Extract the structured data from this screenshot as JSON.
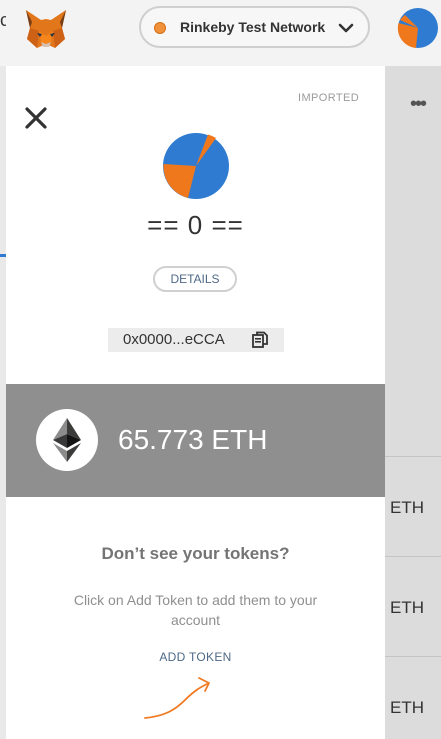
{
  "header": {
    "network_label": "Rinkeby Test Network",
    "left_cut_text": "c",
    "icons": {
      "logo": "metamask-fox-icon",
      "chevron": "chevron-down-icon",
      "avatar": "account-avatar-icon"
    },
    "colors": {
      "network_dot": "#f0913c"
    }
  },
  "background_page": {
    "menu_label": "•••",
    "eth_labels": [
      "ETH",
      "ETH",
      "ETH"
    ]
  },
  "modal": {
    "imported_label": "IMPORTED",
    "account_name": "== 0 ==",
    "details_label": "DETAILS",
    "address": "0x0000...eCCA",
    "balance": "65.773 ETH",
    "no_tokens_title": "Don’t see your tokens?",
    "no_tokens_desc": "Click on Add Token to add them to your account",
    "add_token_label": "ADD TOKEN",
    "icons": {
      "close": "close-icon",
      "copy": "copy-icon",
      "eth": "ethereum-icon"
    },
    "colors": {
      "balance_band": "#8f8f8f",
      "link": "#4e6987",
      "annotation": "#f07a22"
    }
  }
}
